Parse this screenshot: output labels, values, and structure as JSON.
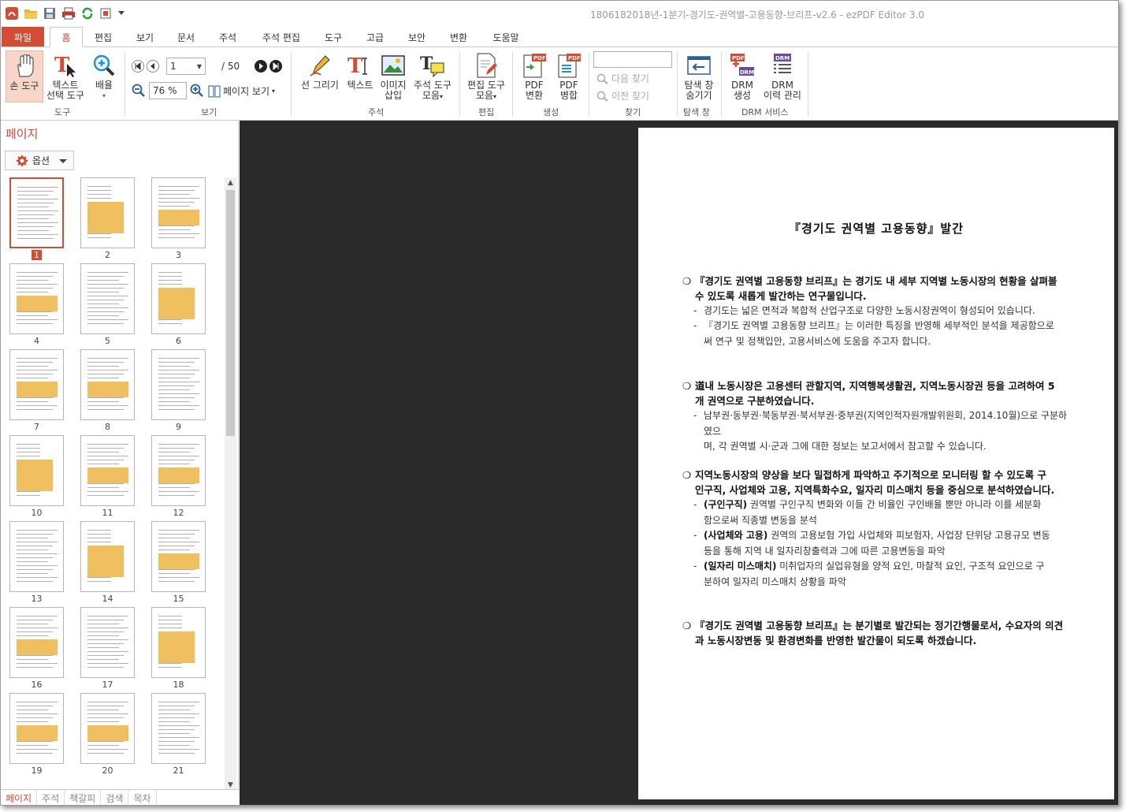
{
  "window": {
    "title": "1806182018년-1분기-경기도-권역별-고용동향-브리프-v2.6 -  ezPDF Editor 3.0"
  },
  "colors": {
    "accent": "#d24d33",
    "doc_bg": "#2a2a2a"
  },
  "menu": {
    "file": "파일",
    "tabs": [
      "홈",
      "편집",
      "보기",
      "문서",
      "주석",
      "주석 편집",
      "도구",
      "고급",
      "보안",
      "변환",
      "도움말"
    ],
    "active_tab": "홈"
  },
  "ribbon": {
    "hand_tool": "손 도구",
    "text_select_1": "텍스트",
    "text_select_2": "선택 도구",
    "zoom_1": "배율",
    "group_tool": "도구",
    "page_value": "1",
    "page_total": "/ 50",
    "zoom_value": "76 %",
    "page_view": "페이지 보기",
    "group_view": "보기",
    "line_draw": "선 그리기",
    "text_note": "텍스트",
    "image_insert_1": "이미지",
    "image_insert_2": "삽입",
    "note_tools_1": "주석 도구",
    "note_tools_2": "모음",
    "group_note": "주석",
    "edit_tools_1": "편집 도구",
    "edit_tools_2": "모음",
    "group_edit": "편집",
    "pdf_convert_1": "PDF",
    "pdf_convert_2": "변환",
    "pdf_merge_1": "PDF",
    "pdf_merge_2": "병합",
    "group_create": "생성",
    "find_next": "다음 찾기",
    "find_prev": "이전 찾기",
    "group_find": "찾기",
    "hide_nav_1": "탐색 창",
    "hide_nav_2": "숨기기",
    "group_nav": "탐색 창",
    "drm_create_1": "DRM",
    "drm_create_2": "생성",
    "drm_history_1": "DRM",
    "drm_history_2": "이력 관리",
    "group_drm": "DRM 서비스"
  },
  "left_panel": {
    "title": "페이지",
    "options": "옵션",
    "selected_page": 1,
    "thumbnails": [
      "1",
      "2",
      "3",
      "4",
      "5",
      "6",
      "7",
      "8",
      "9",
      "10",
      "11",
      "12",
      "13",
      "14",
      "15",
      "16",
      "17",
      "18",
      "19",
      "20",
      "21"
    ],
    "bottom_tabs": [
      "페이지",
      "주석",
      "책갈피",
      "검색",
      "목차"
    ]
  },
  "document": {
    "title": "『경기도 권역별 고용동향』발간",
    "bullet1_line1": "『경기도 권역별 고용동향 브리프』는 경기도 내 세부 지역별 노동시장의 현황을 살펴볼",
    "bullet1_line2": "수 있도록 새롭게 발간하는 연구물입니다.",
    "b1_sub1": "경기도는 넓은 면적과 복합적 산업구조로 다양한 노동시장권역이 형성되어 있습니다.",
    "b1_sub2_line1": "『경기도 권역별 고용동향 브리프』는 이러한 특징을 반영해 세부적인 분석을 제공함으로",
    "b1_sub2_line2": "써 연구 및 정책입안, 고용서비스에 도움을 주고자 합니다.",
    "bullet2_line1": "道내 노동시장은 고용센터 관할지역, 지역행복생활권, 지역노동시장권 등을 고려하여 5",
    "bullet2_line2": "개 권역으로 구분하였습니다.",
    "b2_sub1_line1": "남부권·동부권·북동부권·북서부권·중부권(지역인적자원개발위원회, 2014.10월)으로 구분하였으",
    "b2_sub1_line2": "며, 각 권역별 시·군과 그에 대한 정보는 보고서에서 참고할 수 있습니다.",
    "bullet3_line1": "지역노동시장의 양상을 보다 밀접하게 파악하고 주기적으로 모니터링 할 수 있도록 구",
    "bullet3_line2": "인구직, 사업체와 고용, 지역특화수요, 일자리 미스매치 등을 중심으로 분석하였습니다.",
    "b3_sub1_label": "(구인구직)",
    "b3_sub1_line1": " 권역별 구인구직 변화와 이들 간 비율인 구인배율 뿐만 아니라 이를 세분화",
    "b3_sub1_line2": "함으로써 직종별 변동을 분석",
    "b3_sub2_label": "(사업체와 고용)",
    "b3_sub2_line1": " 권역의 고용보험 가입 사업체와 피보험자, 사업장 단위당 고용규모 변동",
    "b3_sub2_line2": "등을 통해 지역 내 일자리창출력과 그에 따른 고용변동을 파악",
    "b3_sub3_label": "(일자리 미스매치)",
    "b3_sub3_line1": " 미취업자의 실업유형을 양적 요인, 마찰적 요인, 구조적 요인으로 구",
    "b3_sub3_line2": "분하여 일자리 미스매치 상황을 파악",
    "bullet4_line1": "『경기도 권역별 고용동향 브리프』는 분기별로 발간되는 정기간행물로서, 수요자의 의견",
    "bullet4_line2": "과 노동시장변동 및 환경변화를 반영한 발간물이 되도록 하겠습니다."
  }
}
